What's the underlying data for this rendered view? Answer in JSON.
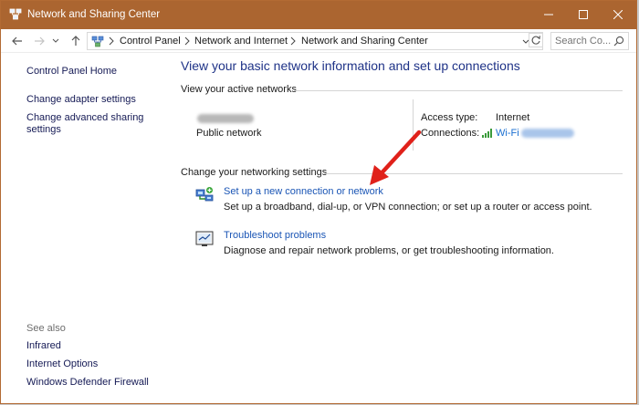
{
  "window": {
    "title": "Network and Sharing Center",
    "accent_color": "#ab6530"
  },
  "titlebar_buttons": {
    "minimize_icon": "minimize-icon",
    "maximize_icon": "maximize-icon",
    "close_icon": "close-icon"
  },
  "address": {
    "crumbs": [
      "Control Panel",
      "Network and Internet",
      "Network and Sharing Center"
    ]
  },
  "search": {
    "placeholder": "Search Co..."
  },
  "sidebar": {
    "home": "Control Panel Home",
    "links": [
      "Change adapter settings",
      "Change advanced sharing settings"
    ],
    "see_also_label": "See also",
    "see_also": [
      "Infrared",
      "Internet Options",
      "Windows Defender Firewall"
    ]
  },
  "main": {
    "heading": "View your basic network information and set up connections",
    "active_networks_label": "View your active networks",
    "network_type": "Public network",
    "access_type_label": "Access type:",
    "access_type_value": "Internet",
    "connections_label": "Connections:",
    "connection_value": "Wi-Fi",
    "change_settings_label": "Change your networking settings",
    "tasks": [
      {
        "title": "Set up a new connection or network",
        "desc": "Set up a broadband, dial-up, or VPN connection; or set up a router or access point.",
        "icon": "new-connection-icon"
      },
      {
        "title": "Troubleshoot problems",
        "desc": "Diagnose and repair network problems, or get troubleshooting information.",
        "icon": "troubleshoot-icon"
      }
    ]
  }
}
